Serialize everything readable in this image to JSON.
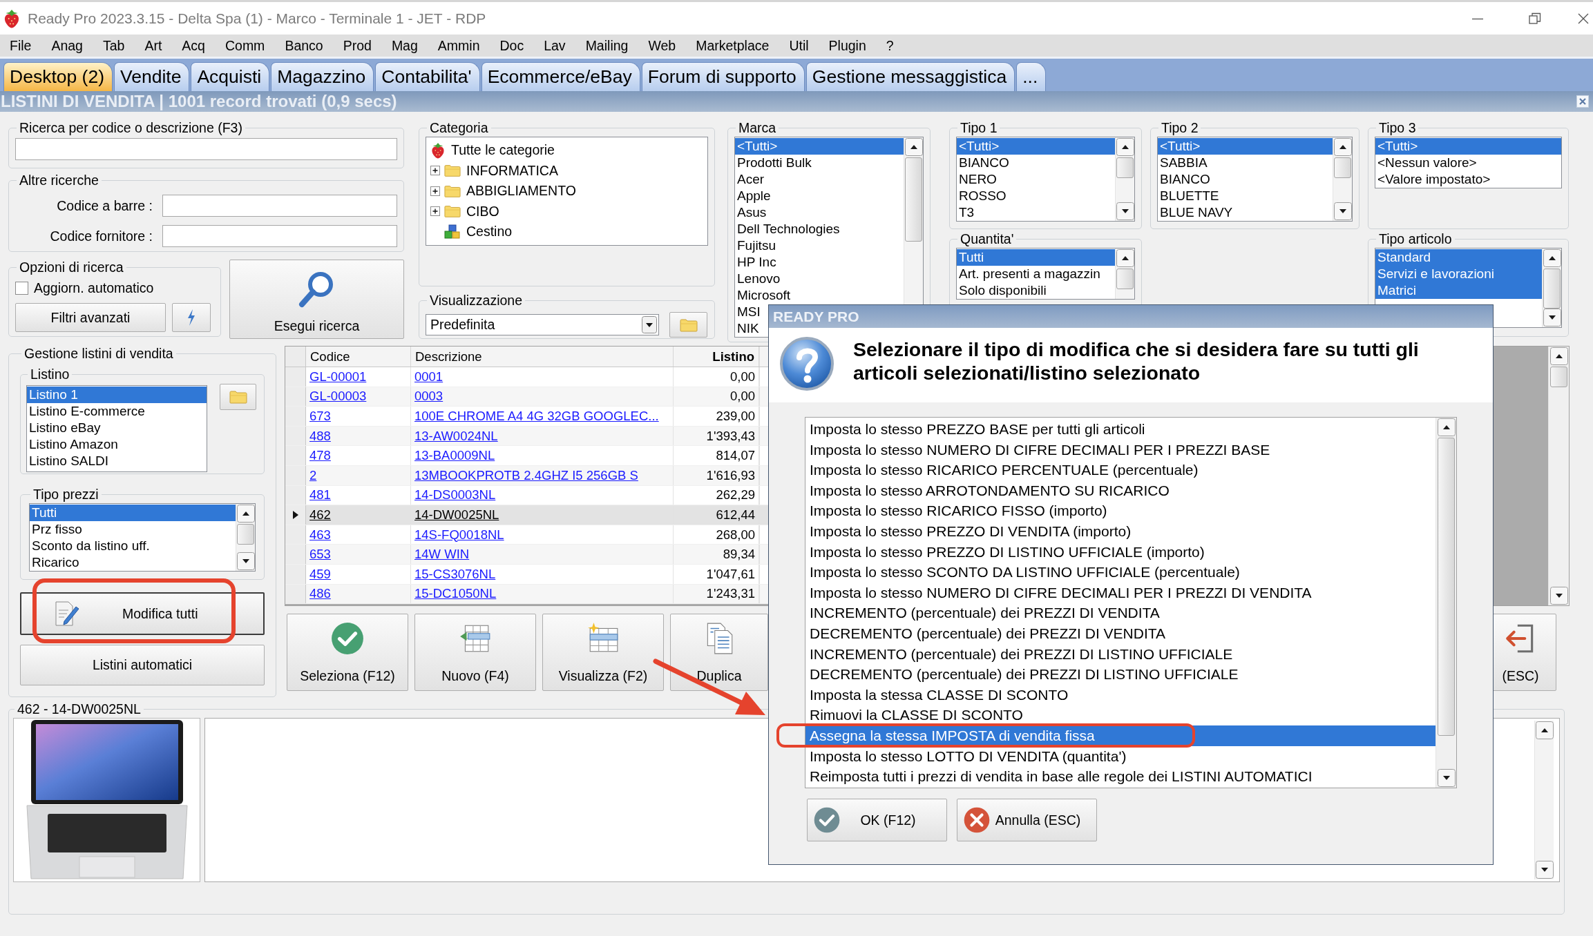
{
  "window": {
    "title": "Ready Pro 2023.3.15 - Delta Spa (1) - Marco - Terminale 1 - JET - RDP"
  },
  "menu": [
    "File",
    "Anag",
    "Tab",
    "Art",
    "Acq",
    "Comm",
    "Banco",
    "Prod",
    "Mag",
    "Ammin",
    "Doc",
    "Lav",
    "Mailing",
    "Web",
    "Marketplace",
    "Util",
    "Plugin",
    "?"
  ],
  "tabs": [
    {
      "label": "Desktop (2)",
      "selected": true
    },
    {
      "label": "Vendite",
      "selected": false
    },
    {
      "label": "Acquisti",
      "selected": false
    },
    {
      "label": "Magazzino",
      "selected": false
    },
    {
      "label": "Contabilita'",
      "selected": false
    },
    {
      "label": "Ecommerce/eBay",
      "selected": false
    },
    {
      "label": "Forum di supporto",
      "selected": false
    },
    {
      "label": "Gestione messaggistica",
      "selected": false
    },
    {
      "label": "...",
      "selected": false
    }
  ],
  "header": {
    "title": "LISTINI DI VENDITA | 1001 record trovati (0,9 secs)"
  },
  "search": {
    "title": "Ricerca per codice o descrizione (F3)"
  },
  "other_searches": {
    "title": "Altre ricerche",
    "fields": [
      {
        "label": "Codice a barre :"
      },
      {
        "label": "Codice fornitore :"
      }
    ]
  },
  "search_options": {
    "title": "Opzioni di ricerca",
    "auto_update": {
      "label": "Aggiorn. automatico",
      "checked": false
    },
    "advanced_filters": "Filtri avanzati"
  },
  "run_search": {
    "label": "Esegui ricerca"
  },
  "category": {
    "title": "Categoria",
    "tree": [
      {
        "label": "Tutte le categorie",
        "kind": "root",
        "children": [
          {
            "label": "INFORMATICA",
            "kind": "folder",
            "expanded": false
          },
          {
            "label": "ABBIGLIAMENTO",
            "kind": "folder",
            "expanded": false
          },
          {
            "label": "CIBO",
            "kind": "folder",
            "expanded": false
          },
          {
            "label": "Cestino",
            "kind": "bin"
          }
        ]
      }
    ]
  },
  "view": {
    "title": "Visualizzazione",
    "value": "Predefinita"
  },
  "filters": [
    {
      "title": "Marca",
      "items": [
        {
          "label": "<Tutti>",
          "selected": true
        },
        {
          "label": "Prodotti Bulk",
          "selected": false
        },
        {
          "label": "Acer",
          "selected": false
        },
        {
          "label": "Apple",
          "selected": false
        },
        {
          "label": "Asus",
          "selected": false
        },
        {
          "label": "Dell Technologies",
          "selected": false
        },
        {
          "label": "Fujitsu",
          "selected": false
        },
        {
          "label": "HP Inc",
          "selected": false
        },
        {
          "label": "Lenovo",
          "selected": false
        },
        {
          "label": "Microsoft",
          "selected": false
        },
        {
          "label": "MSI",
          "selected": false
        },
        {
          "label": "NIK",
          "selected": false
        }
      ]
    },
    {
      "title": "Tipo 1",
      "items": [
        {
          "label": "<Tutti>",
          "selected": true
        },
        {
          "label": "BIANCO",
          "selected": false
        },
        {
          "label": "NERO",
          "selected": false
        },
        {
          "label": "ROSSO",
          "selected": false
        },
        {
          "label": "T3",
          "selected": false
        }
      ]
    },
    {
      "title": "Tipo 2",
      "items": [
        {
          "label": "<Tutti>",
          "selected": true
        },
        {
          "label": "SABBIA",
          "selected": false
        },
        {
          "label": "BIANCO",
          "selected": false
        },
        {
          "label": "BLUETTE",
          "selected": false
        },
        {
          "label": "BLUE NAVY",
          "selected": false
        }
      ]
    },
    {
      "title": "Tipo 3",
      "items": [
        {
          "label": "<Tutti>",
          "selected": true
        },
        {
          "label": "<Nessun valore>",
          "selected": false
        },
        {
          "label": "<Valore impostato>",
          "selected": false
        }
      ]
    },
    {
      "title": "Quantita'",
      "items": [
        {
          "label": "Tutti",
          "selected": true
        },
        {
          "label": "Art. presenti a magazzin",
          "selected": false
        },
        {
          "label": "Solo disponibili",
          "selected": false
        }
      ]
    },
    {
      "title": "Tipo articolo",
      "items": [
        {
          "label": "Standard",
          "selected": true
        },
        {
          "label": "Servizi e lavorazioni",
          "selected": true
        },
        {
          "label": "Matrici",
          "selected": true
        }
      ]
    }
  ],
  "price_lists": {
    "title": "Gestione listini di vendita",
    "list": {
      "title": "Listino",
      "items": [
        {
          "label": "Listino 1",
          "selected": true
        },
        {
          "label": "Listino E-commerce",
          "selected": false
        },
        {
          "label": "Listino eBay",
          "selected": false
        },
        {
          "label": "Listino Amazon",
          "selected": false
        },
        {
          "label": "Listino SALDI",
          "selected": false
        }
      ]
    },
    "price_types": {
      "title": "Tipo prezzi",
      "items": [
        {
          "label": "Tutti",
          "selected": true
        },
        {
          "label": "Prz fisso",
          "selected": false
        },
        {
          "label": "Sconto da listino uff.",
          "selected": false
        },
        {
          "label": "Ricarico",
          "selected": false
        }
      ]
    },
    "buttons": [
      {
        "label": "Modifica tutti",
        "kind": "edit"
      },
      {
        "label": "Listini automatici",
        "kind": "plain"
      }
    ]
  },
  "grid": {
    "columns": [
      {
        "label": "Codice",
        "kind": "link"
      },
      {
        "label": "Descrizione",
        "kind": "link"
      },
      {
        "label": "Listino",
        "kind": "number"
      }
    ],
    "rows": [
      {
        "cells": [
          "GL-00001",
          "0001",
          "0,00"
        ],
        "selected": false
      },
      {
        "cells": [
          "GL-00003",
          "0003",
          "0,00"
        ],
        "selected": false
      },
      {
        "cells": [
          "673",
          "100E CHROME A4 4G 32GB GOOGLEC...",
          "239,00"
        ],
        "selected": false
      },
      {
        "cells": [
          "488",
          "13-AW0024NL",
          "1'393,43"
        ],
        "selected": false
      },
      {
        "cells": [
          "478",
          "13-BA0009NL",
          "814,07"
        ],
        "selected": false
      },
      {
        "cells": [
          "2",
          "13MBOOKPROTB 2.4GHZ I5 256GB S",
          "1'616,93"
        ],
        "selected": false
      },
      {
        "cells": [
          "481",
          "14-DS0003NL",
          "262,29"
        ],
        "selected": false
      },
      {
        "cells": [
          "462",
          "14-DW0025NL",
          "612,44"
        ],
        "selected": true
      },
      {
        "cells": [
          "463",
          "14S-FQ0018NL",
          "268,00"
        ],
        "selected": false
      },
      {
        "cells": [
          "653",
          "14W WIN",
          "89,34"
        ],
        "selected": false
      },
      {
        "cells": [
          "459",
          "15-CS3076NL",
          "1'047,61"
        ],
        "selected": false
      },
      {
        "cells": [
          "486",
          "15-DC1050NL",
          "1'243,31"
        ],
        "selected": false
      }
    ]
  },
  "actions": [
    {
      "label": "Seleziona (F12)",
      "kind": "select"
    },
    {
      "label": "Nuovo (F4)",
      "kind": "new"
    },
    {
      "label": "Visualizza (F2)",
      "kind": "view"
    },
    {
      "label": "Duplica",
      "kind": "duplicate"
    },
    {
      "label": "(ESC)",
      "kind": "close"
    }
  ],
  "detail": {
    "title": "462 - 14-DW0025NL"
  },
  "dialog": {
    "title": "READY PRO",
    "message": "Selezionare il tipo di modifica che si desidera fare su tutti gli articoli selezionati/listino selezionato",
    "options": [
      {
        "label": "Imposta lo stesso PREZZO BASE per tutti gli articoli",
        "selected": false
      },
      {
        "label": "Imposta lo stesso NUMERO DI CIFRE DECIMALI PER I PREZZI BASE",
        "selected": false
      },
      {
        "label": "Imposta lo stesso RICARICO PERCENTUALE (percentuale)",
        "selected": false
      },
      {
        "label": "Imposta lo stesso ARROTONDAMENTO SU RICARICO",
        "selected": false
      },
      {
        "label": "Imposta lo stesso RICARICO FISSO (importo)",
        "selected": false
      },
      {
        "label": "Imposta lo stesso PREZZO DI VENDITA (importo)",
        "selected": false
      },
      {
        "label": "Imposta lo stesso PREZZO DI LISTINO UFFICIALE (importo)",
        "selected": false
      },
      {
        "label": "Imposta lo stesso SCONTO DA LISTINO UFFICIALE (percentuale)",
        "selected": false
      },
      {
        "label": "Imposta lo stesso NUMERO DI CIFRE DECIMALI PER I PREZZI DI VENDITA",
        "selected": false
      },
      {
        "label": "INCREMENTO (percentuale) dei PREZZI DI VENDITA",
        "selected": false
      },
      {
        "label": "DECREMENTO (percentuale) dei PREZZI DI VENDITA",
        "selected": false
      },
      {
        "label": "INCREMENTO (percentuale) dei PREZZI DI LISTINO UFFICIALE",
        "selected": false
      },
      {
        "label": "DECREMENTO (percentuale) dei PREZZI DI LISTINO UFFICIALE",
        "selected": false
      },
      {
        "label": "Imposta la stessa CLASSE DI SCONTO",
        "selected": false
      },
      {
        "label": "Rimuovi la CLASSE DI SCONTO",
        "selected": false
      },
      {
        "label": "Assegna la stessa IMPOSTA di vendita fissa",
        "selected": true
      },
      {
        "label": "Imposta lo stesso LOTTO DI VENDITA (quantita')",
        "selected": false
      },
      {
        "label": "Reimposta tutti i prezzi di vendita in base alle regole dei LISTINI AUTOMATICI",
        "selected": false
      }
    ],
    "buttons": [
      {
        "label": "OK (F12)",
        "kind": "ok"
      },
      {
        "label": "Annulla (ESC)",
        "kind": "cancel"
      }
    ]
  }
}
